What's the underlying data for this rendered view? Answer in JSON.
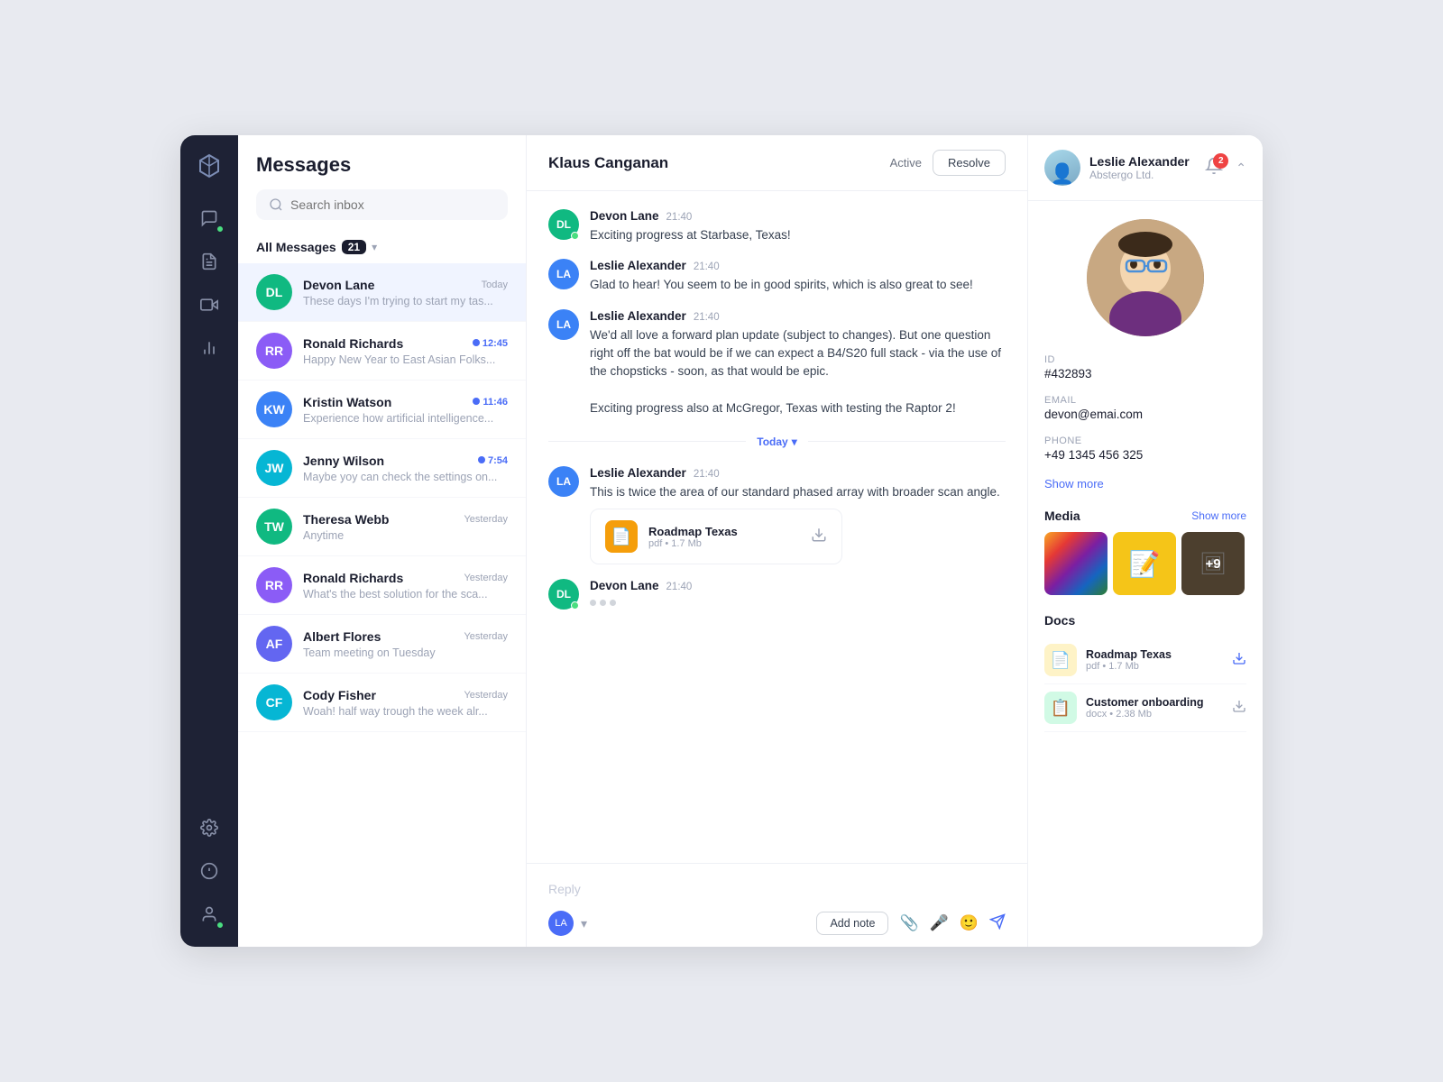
{
  "app": {
    "title": "Messages"
  },
  "sidebar": {
    "items": [
      {
        "name": "logo",
        "icon": "logo"
      },
      {
        "name": "chat",
        "icon": "chat",
        "active": true
      },
      {
        "name": "document",
        "icon": "document"
      },
      {
        "name": "video",
        "icon": "video"
      },
      {
        "name": "chart",
        "icon": "chart"
      },
      {
        "name": "settings",
        "icon": "settings"
      },
      {
        "name": "info",
        "icon": "info"
      },
      {
        "name": "user",
        "icon": "user",
        "badge": true
      }
    ]
  },
  "header": {
    "notification_count": "2",
    "user_name": "Leslie Alexander",
    "user_company": "Abstergo Ltd."
  },
  "search": {
    "placeholder": "Search inbox"
  },
  "filter": {
    "label": "All Messages",
    "count": "21"
  },
  "conversations": [
    {
      "name": "Devon Lane",
      "time": "Today",
      "preview": "These days I'm trying to start my tas...",
      "avatar_initials": "DL",
      "avatar_color": "av-green",
      "unread": false,
      "active": true
    },
    {
      "name": "Ronald Richards",
      "time": "12:45",
      "preview": "Happy New Year to East Asian Folks...",
      "avatar_initials": "RR",
      "avatar_color": "av-purple",
      "unread": true
    },
    {
      "name": "Kristin Watson",
      "time": "11:46",
      "preview": "Experience how artificial intelligence...",
      "avatar_initials": "KW",
      "avatar_color": "av-blue",
      "unread": true
    },
    {
      "name": "Jenny Wilson",
      "time": "7:54",
      "preview": "Maybe yoy can check the settings on...",
      "avatar_initials": "JW",
      "avatar_color": "av-teal",
      "unread": true
    },
    {
      "name": "Theresa Webb",
      "time": "Yesterday",
      "preview": "Anytime",
      "avatar_initials": "TW",
      "avatar_color": "av-green",
      "unread": false
    },
    {
      "name": "Ronald Richards",
      "time": "Yesterday",
      "preview": "What's the best solution for the sca...",
      "avatar_initials": "RR",
      "avatar_color": "av-purple",
      "unread": false
    },
    {
      "name": "Albert Flores",
      "time": "Yesterday",
      "preview": "Team meeting on Tuesday",
      "avatar_initials": "AF",
      "avatar_color": "av-indigo",
      "unread": false
    },
    {
      "name": "Cody Fisher",
      "time": "Yesterday",
      "preview": "Woah! half way trough the week alr...",
      "avatar_initials": "CF",
      "avatar_color": "av-teal",
      "unread": false
    }
  ],
  "chat": {
    "contact_name": "Klaus Canganan",
    "status": "Active",
    "resolve_label": "Resolve",
    "messages": [
      {
        "sender": "Devon Lane",
        "time": "21:40",
        "text": "Exciting progress at Starbase, Texas!",
        "type": "user",
        "initials": "DL",
        "color": "av-green",
        "online": true
      },
      {
        "sender": "Leslie Alexander",
        "time": "21:40",
        "text": "Glad to hear! You seem to be in good spirits, which is also great to see!",
        "type": "agent",
        "initials": "LA",
        "color": "av-blue"
      },
      {
        "sender": "Leslie Alexander",
        "time": "21:40",
        "text": "We'd all love a forward plan update (subject to changes). But one question right off the bat would be if we can expect a B4/S20 full stack - via the use of the chopsticks - soon, as that would be epic.\n\nExciting progress also at McGregor, Texas with testing the Raptor 2!",
        "type": "agent",
        "initials": "LA",
        "color": "av-blue"
      }
    ],
    "divider": "Today",
    "messages2": [
      {
        "sender": "Leslie Alexander",
        "time": "21:40",
        "text": "This is twice the area of our standard phased array with broader scan angle.",
        "type": "agent",
        "initials": "LA",
        "color": "av-blue",
        "has_attachment": true,
        "attachment": {
          "name": "Roadmap Texas",
          "meta": "pdf • 1.7 Mb"
        }
      },
      {
        "sender": "Devon Lane",
        "time": "21:40",
        "text": "",
        "type": "user",
        "initials": "DL",
        "color": "av-green",
        "online": true,
        "typing": true
      }
    ],
    "reply_placeholder": "Reply",
    "add_note_label": "Add note"
  },
  "profile": {
    "id": "#432893",
    "email": "devon@emai.com",
    "phone": "+49 1345 456 325",
    "show_more": "Show more",
    "media_label": "Media",
    "media_show_more": "Show more",
    "media_plus": "+9",
    "docs_label": "Docs",
    "docs": [
      {
        "name": "Roadmap Texas",
        "meta": "pdf • 1.7 Mb",
        "type": "orange"
      },
      {
        "name": "Customer onboarding",
        "meta": "docx • 2.38 Mb",
        "type": "green"
      }
    ]
  }
}
